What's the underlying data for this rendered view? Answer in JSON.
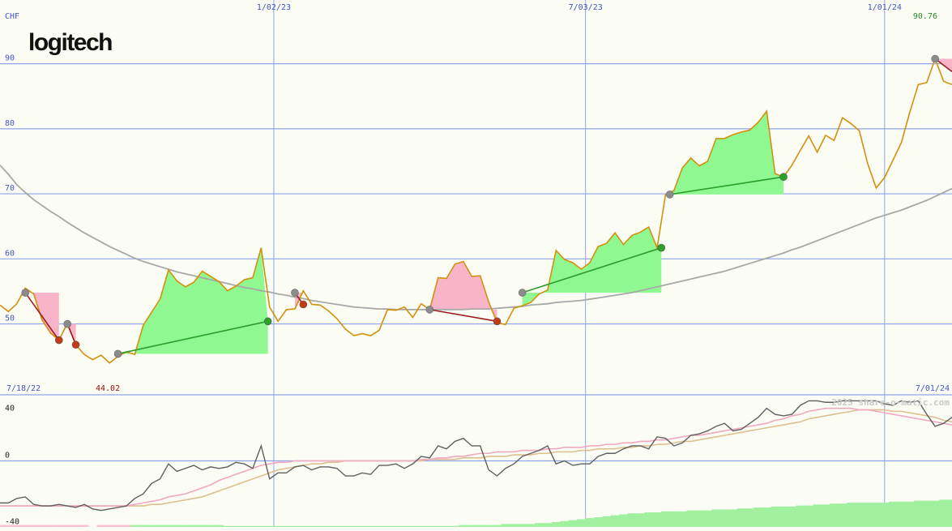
{
  "brand": {
    "logo_text": "logitech"
  },
  "colors": {
    "background": "#fbfcf4",
    "grid": "#8fa4e8",
    "price": "#d4900c",
    "ma": "#a8a8a8",
    "win_fill": "#90f890",
    "loss_fill": "#f8b4c8",
    "win_line": "#2a9e2a",
    "loss_line": "#9c1e1e",
    "gray_dot": "#8c8c8c",
    "green_dot": "#2aa12a",
    "red_dot": "#c53a14",
    "label_blue": "#4055c8",
    "label_red": "#a01010",
    "label_green": "#2a8a2a",
    "osc_dark": "#606060",
    "osc_pink": "#f0a8c0",
    "osc_tan": "#dcc090",
    "vol_green": "#a0f0a0",
    "vol_pink": "#f8c0d0"
  },
  "chart_data": [
    {
      "type": "line",
      "title": "",
      "currency_label": "CHF",
      "x_labels": [
        "1/02/23",
        "7/03/23",
        "1/01/24"
      ],
      "start_label": "7/18/22",
      "end_label": "7/01/24",
      "min_label": "44.02",
      "last_label": "90.76",
      "y_ticks": [
        50,
        60,
        70,
        80,
        90
      ],
      "ylim": [
        39.1,
        99.8
      ],
      "series": [
        {
          "values": [
            52.9,
            51.9,
            53.1,
            55.5,
            54.6,
            50.6,
            48.6,
            47.5,
            50.1,
            46.8,
            45.3,
            44.5,
            45.2,
            44.0,
            45.0,
            45.7,
            45.3,
            49.8,
            51.8,
            53.8,
            58.3,
            56.6,
            55.7,
            56.4,
            58.1,
            57.3,
            56.5,
            55.1,
            55.8,
            56.8,
            57.1,
            61.7,
            52.6,
            50.4,
            52.2,
            52.3,
            55.1,
            53.0,
            52.9,
            52.0,
            50.8,
            49.2,
            48.2,
            48.5,
            48.2,
            49.0,
            52.2,
            52.1,
            52.6,
            51.0,
            53.1,
            52.2,
            57.1,
            57.0,
            59.2,
            59.6,
            57.3,
            57.4,
            53.4,
            50.2,
            49.9,
            52.4,
            52.8,
            53.3,
            54.6,
            55.2,
            61.3,
            59.9,
            59.4,
            58.4,
            59.4,
            61.9,
            62.4,
            64.0,
            62.2,
            63.6,
            64.1,
            64.9,
            61.7,
            69.9,
            70.5,
            74.0,
            75.5,
            74.3,
            75.0,
            78.5,
            78.5,
            79.1,
            79.5,
            79.8,
            81.0,
            82.7,
            73.1,
            72.6,
            74.4,
            76.7,
            78.9,
            76.4,
            79.0,
            78.2,
            81.7,
            80.8,
            79.7,
            74.6,
            70.9,
            72.5,
            75.2,
            77.9,
            82.6,
            86.8,
            87.1,
            90.76,
            87.3,
            86.8
          ]
        },
        {
          "values": [
            74.4,
            73.0,
            71.4,
            70.2,
            69.1,
            68.2,
            67.3,
            66.5,
            65.6,
            64.8,
            64.0,
            63.3,
            62.6,
            61.9,
            61.3,
            60.7,
            60.1,
            59.6,
            59.2,
            58.8,
            58.4,
            58.0,
            57.7,
            57.4,
            57.1,
            56.8,
            56.5,
            56.2,
            55.9,
            55.6,
            55.4,
            55.1,
            54.9,
            54.6,
            54.4,
            54.1,
            53.9,
            53.6,
            53.4,
            53.2,
            53.0,
            52.8,
            52.6,
            52.5,
            52.4,
            52.3,
            52.3,
            52.2,
            52.2,
            52.2,
            52.2,
            52.2,
            52.2,
            52.2,
            52.2,
            52.2,
            52.3,
            52.3,
            52.3,
            52.4,
            52.5,
            52.6,
            52.7,
            52.9,
            53.0,
            53.1,
            53.3,
            53.4,
            53.5,
            53.6,
            53.8,
            54.0,
            54.2,
            54.4,
            54.6,
            54.8,
            55.1,
            55.4,
            55.7,
            56.0,
            56.3,
            56.6,
            56.9,
            57.2,
            57.5,
            57.8,
            58.1,
            58.5,
            58.9,
            59.3,
            59.7,
            60.1,
            60.5,
            60.9,
            61.4,
            61.8,
            62.3,
            62.8,
            63.3,
            63.8,
            64.3,
            64.8,
            65.3,
            65.8,
            66.3,
            66.7,
            67.1,
            67.5,
            68.0,
            68.5,
            69.0,
            69.6,
            70.2,
            70.8,
            71.4,
            72.1
          ]
        }
      ],
      "trades": [
        {
          "entry": [
            3,
            54.8
          ],
          "exit": [
            7,
            47.5
          ],
          "result": "loss"
        },
        {
          "entry": [
            8,
            50.0
          ],
          "exit": [
            9,
            46.8
          ],
          "result": "loss"
        },
        {
          "entry": [
            14,
            45.4
          ],
          "exit": [
            31.8,
            50.4
          ],
          "result": "win"
        },
        {
          "entry": [
            35,
            54.8
          ],
          "exit": [
            36,
            53.0
          ],
          "result": "loss"
        },
        {
          "entry": [
            51,
            52.2
          ],
          "exit": [
            59,
            50.4
          ],
          "result": "loss"
        },
        {
          "entry": [
            62,
            54.8
          ],
          "exit": [
            78.5,
            61.7
          ],
          "result": "win"
        },
        {
          "entry": [
            79.5,
            69.9
          ],
          "exit": [
            93,
            72.6
          ],
          "result": "win"
        },
        {
          "entry": [
            111,
            90.76
          ],
          "exit": [
            115,
            86.8
          ],
          "result": "loss"
        }
      ]
    },
    {
      "type": "line",
      "y_ticks": [
        40,
        0,
        -40
      ],
      "ylim": [
        -44,
        44
      ],
      "watermark": "2025 share-o-matic.com",
      "series": [
        {
          "values": [
            -28,
            -28,
            -25,
            -24,
            -29,
            -30,
            -30,
            -29,
            -30,
            -31,
            -29,
            -32,
            -33,
            -32,
            -31,
            -30,
            -25,
            -22,
            -15,
            -12,
            -2,
            -7,
            -5,
            -3,
            -6,
            -4,
            -5,
            -4,
            -1,
            -2,
            -5,
            10,
            -12,
            -8,
            -8,
            -4,
            -3,
            -6,
            -4,
            -4,
            -5,
            -10,
            -10,
            -8,
            -9,
            -3,
            -3,
            -2,
            -5,
            -2,
            3,
            2,
            10,
            8,
            13,
            15,
            10,
            10,
            -6,
            -10,
            -5,
            -2,
            3,
            5,
            7,
            10,
            -2,
            0,
            -3,
            -2,
            -2,
            3,
            5,
            5,
            8,
            10,
            10,
            8,
            16,
            15,
            10,
            12,
            17,
            18,
            20,
            23,
            25,
            20,
            21,
            25,
            29,
            35,
            31,
            30,
            31,
            37,
            40,
            40,
            39,
            39,
            40,
            40,
            40,
            40,
            40,
            38,
            37,
            40,
            39,
            40,
            31,
            23,
            25,
            29,
            30,
            33
          ]
        },
        {
          "values": [
            -30,
            -30,
            -30,
            -30,
            -30,
            -30,
            -30,
            -30,
            -30,
            -30,
            -30,
            -30,
            -30,
            -30,
            -30,
            -30,
            -29,
            -28,
            -27,
            -26,
            -24,
            -23,
            -22,
            -20,
            -18,
            -16,
            -13,
            -11,
            -9,
            -7,
            -5,
            -3,
            -2,
            -1,
            -1,
            0,
            0,
            0,
            0,
            0,
            0,
            0,
            0,
            0,
            0,
            0,
            0,
            0,
            0,
            0,
            1,
            1,
            2,
            2,
            3,
            3,
            4,
            5,
            5,
            6,
            6,
            6,
            7,
            7,
            7,
            8,
            8,
            9,
            9,
            9,
            10,
            10,
            11,
            11,
            12,
            12,
            13,
            13,
            14,
            14,
            15,
            16,
            17,
            17,
            18,
            19,
            20,
            21,
            22,
            23,
            24,
            25,
            27,
            28,
            30,
            31,
            33,
            34,
            35,
            35,
            35,
            35,
            34,
            34,
            33,
            32,
            31,
            30,
            29,
            28,
            27,
            26,
            25,
            24,
            24,
            24
          ]
        },
        {
          "values": [
            -30,
            -30,
            -30,
            -30,
            -30,
            -30,
            -30,
            -30,
            -30,
            -30,
            -30,
            -30,
            -30,
            -30,
            -30,
            -30,
            -30,
            -30,
            -29,
            -29,
            -28,
            -27,
            -26,
            -25,
            -24,
            -22,
            -20,
            -18,
            -16,
            -14,
            -12,
            -10,
            -8,
            -6,
            -5,
            -4,
            -3,
            -2,
            -2,
            -1,
            -1,
            0,
            0,
            0,
            0,
            0,
            0,
            0,
            0,
            0,
            0,
            1,
            1,
            1,
            1,
            2,
            2,
            2,
            3,
            3,
            3,
            4,
            4,
            4,
            5,
            5,
            6,
            6,
            6,
            7,
            7,
            8,
            8,
            8,
            9,
            9,
            10,
            10,
            11,
            11,
            12,
            13,
            13,
            14,
            15,
            16,
            17,
            18,
            19,
            20,
            21,
            22,
            23,
            24,
            25,
            26,
            28,
            29,
            30,
            31,
            32,
            33,
            34,
            34,
            34,
            34,
            33,
            33,
            32,
            31,
            30,
            29,
            27,
            26,
            25,
            25
          ]
        }
      ]
    },
    {
      "type": "bar",
      "values": [
        -2,
        -2,
        -2,
        -2,
        -2,
        -2,
        -2,
        -2,
        -2,
        -2,
        -2,
        0,
        -2,
        -2,
        -2,
        -2,
        2,
        2,
        2,
        2,
        2,
        2,
        2,
        2,
        2,
        2,
        2,
        1,
        1,
        1,
        1,
        1,
        1,
        1,
        1,
        1,
        1,
        1,
        1,
        1,
        1,
        1,
        1,
        1,
        1,
        1,
        1,
        1,
        1,
        1,
        1,
        1,
        1,
        1,
        1,
        2,
        2,
        2,
        2,
        2,
        3,
        3,
        3,
        3,
        4,
        4,
        5,
        6,
        7,
        8,
        9,
        10,
        11,
        12,
        13,
        14,
        14,
        15,
        15,
        16,
        16,
        16,
        17,
        17,
        17,
        18,
        18,
        18,
        19,
        19,
        20,
        20,
        21,
        21,
        21,
        22,
        22,
        23,
        23,
        24,
        24,
        25,
        25,
        25,
        25,
        25,
        26,
        26,
        26,
        27,
        27,
        27,
        28,
        28,
        29,
        29
      ],
      "ylim": [
        0,
        40
      ]
    }
  ]
}
